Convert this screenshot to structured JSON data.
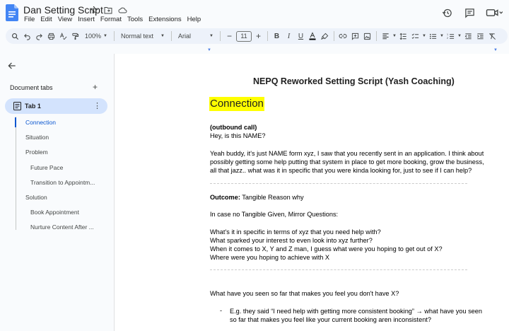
{
  "app": {
    "title": "Dan Setting Script",
    "menu": [
      "File",
      "Edit",
      "View",
      "Insert",
      "Format",
      "Tools",
      "Extensions",
      "Help"
    ],
    "brand_color": "#4285f4",
    "accent_color": "#0b57d0"
  },
  "toolbar": {
    "zoom": "100%",
    "style": "Normal text",
    "font": "Arial",
    "font_size": "11",
    "icons": [
      "search-icon",
      "undo-icon",
      "redo-icon",
      "print-icon",
      "spellcheck-icon",
      "paint-format-icon",
      "bold-icon",
      "italic-icon",
      "underline-icon",
      "text-color-icon",
      "highlight-icon",
      "link-icon",
      "comment-icon",
      "image-icon",
      "align-icon",
      "line-spacing-icon",
      "checklist-icon",
      "bullet-list-icon",
      "numbered-list-icon",
      "decrease-indent-icon",
      "increase-indent-icon",
      "clear-format-icon"
    ]
  },
  "sidebar": {
    "heading": "Document tabs",
    "tab": {
      "label": "Tab 1"
    },
    "outline": [
      {
        "label": "Connection",
        "active": true
      },
      {
        "label": "Situation"
      },
      {
        "label": "Problem"
      },
      {
        "label": "Future Pace"
      },
      {
        "label": "Transition to Appointm..."
      },
      {
        "label": "Solution"
      },
      {
        "label": "Book Appointment"
      },
      {
        "label": "Nurture Content After ..."
      }
    ]
  },
  "document": {
    "title": "NEPQ Reworked Setting Script (Yash Coaching)",
    "heading": "Connection",
    "outbound_label": "(outbound call)",
    "greeting": "Hey, is this NAME?",
    "pitch_line1": "Yeah buddy, it's just NAME form xyz, I saw that you recently sent in an application. I think about",
    "pitch_line2": "possibly getting some help putting that system in place to get more booking, grow the business,",
    "pitch_line3": "all that jazz.. what was it in specific that you were kinda looking for, just to see if I can help?",
    "outcome_label": "Outcome:",
    "outcome_value": "Tangible Reason why",
    "no_tangible": "In case no Tangible Given, Mirror Questions:",
    "q1": "What's it in specific in terms of xyz that you need help with?",
    "q2": "What sparked your interest to even look into xyz further?",
    "q3": "When it comes to X, Y and Z man, I guess what were you hoping to get out of X?",
    "q4": "Where were you hoping to achieve with X",
    "q5": "What have you seen so far that makes you feel you don't have X?",
    "bullet_dash": "-",
    "bullet_line1": "E.g. they said “I need help with getting more consistent booking” → what have you seen",
    "bullet_line2": "so far that makes you feel like your current booking aren inconsistent?"
  }
}
